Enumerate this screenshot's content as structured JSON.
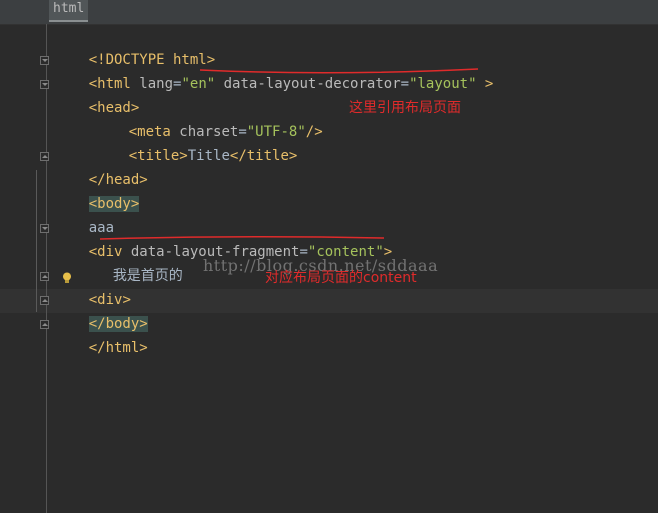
{
  "tab": {
    "label": "html"
  },
  "code": {
    "l1": {
      "text": "<!DOCTYPE html>"
    },
    "l2": {
      "open": "<html",
      "attr1": " lang",
      "eq1": "=",
      "val1": "\"en\"",
      "attr2": " data-layout-decorator",
      "eq2": "=",
      "val2": "\"layout\"",
      "close": " >"
    },
    "l3": {
      "text": "<head>"
    },
    "l4": {
      "open": "<meta",
      "attr": " charset",
      "eq": "=",
      "val": "\"UTF-8\"",
      "close": "/>"
    },
    "l5": {
      "open": "<title>",
      "content": "Title",
      "close": "</title>"
    },
    "l6": {
      "text": "</head>"
    },
    "l7": {
      "text": "<body>"
    },
    "l8": {
      "text": "aaa"
    },
    "l9": {
      "open": "<div",
      "attr": " data-layout-fragment",
      "eq": "=",
      "val": "\"content\"",
      "close": ">"
    },
    "l10": {
      "text": "我是首页的"
    },
    "l11": {
      "lt": "<",
      "rest": "div>"
    },
    "l12": {
      "text": "</body>"
    },
    "l13": {
      "text": "</html>"
    }
  },
  "annotations": {
    "layout_ref": "这里引用布局页面",
    "content_ref": "对应布局页面的content"
  },
  "watermark": "http://blog.csdn.net/sddaaa",
  "colors": {
    "background": "#2b2b2b",
    "tag": "#e8bf6a",
    "attribute": "#bababa",
    "string": "#a5c25c",
    "annotation": "#e02b2b"
  }
}
